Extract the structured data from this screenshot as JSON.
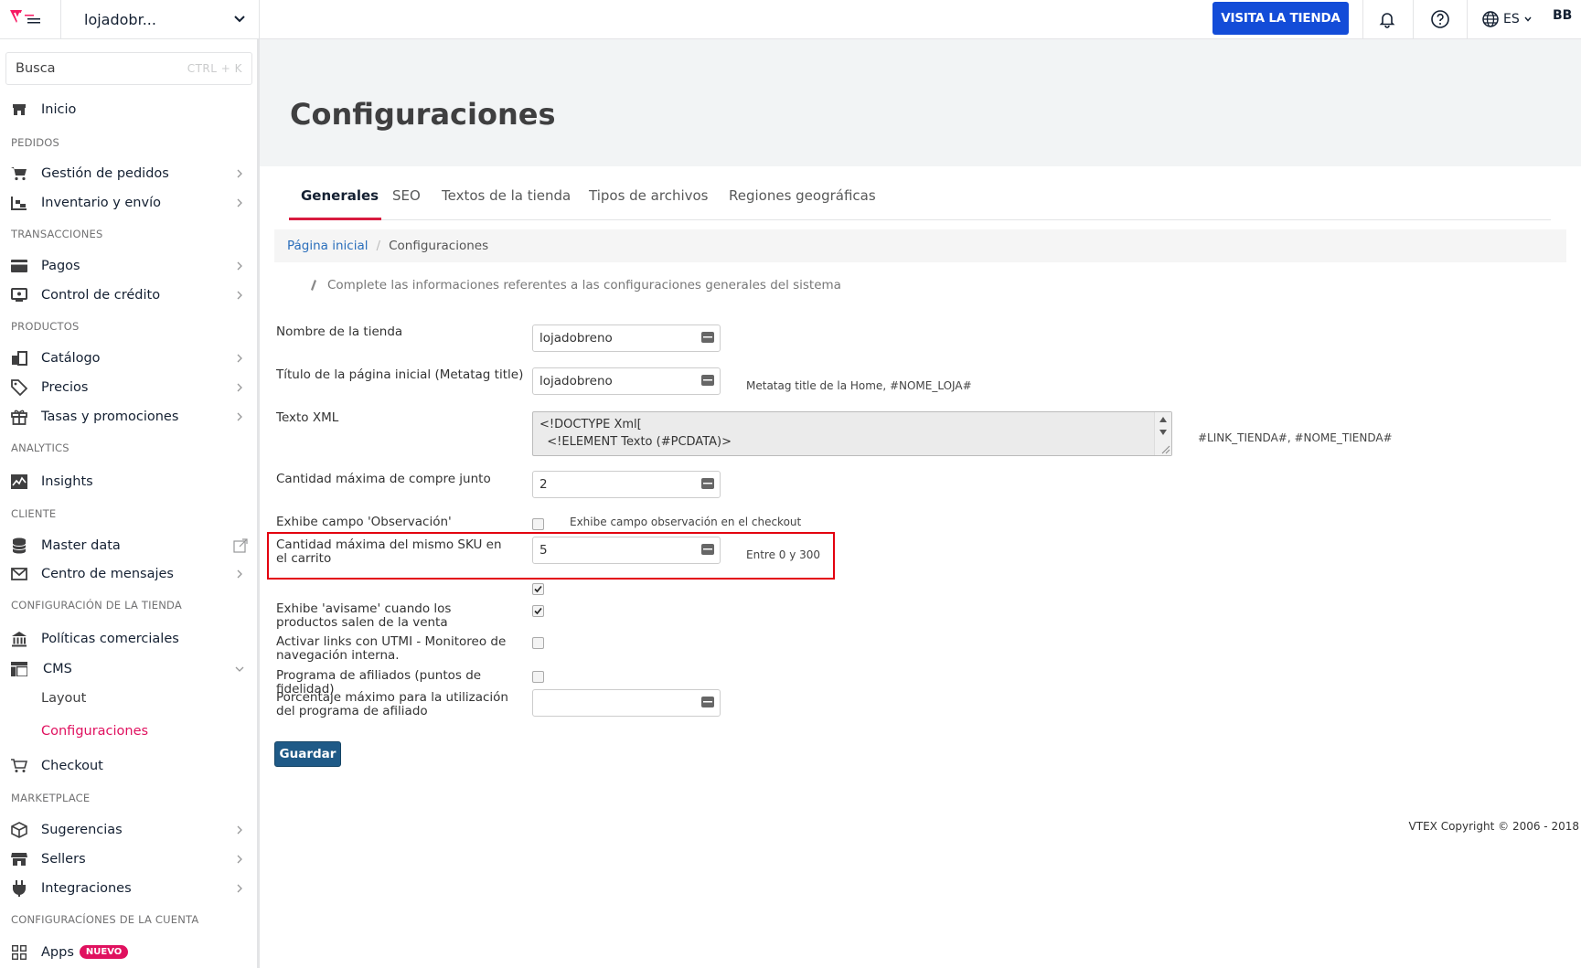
{
  "topbar": {
    "store_name": "lojadobr...",
    "visit_store": "VISITA LA TIENDA",
    "language": "ES",
    "avatar": "BB"
  },
  "sidebar": {
    "search_placeholder": "Busca",
    "search_shortcut": "CTRL + K",
    "home": "Inicio",
    "sections": {
      "pedidos": "PEDIDOS",
      "transacciones": "TRANSACCIONES",
      "productos": "PRODUCTOS",
      "analytics": "ANALYTICS",
      "cliente": "CLIENTE",
      "config_tienda": "CONFIGURACIÓN DE LA TIENDA",
      "marketplace": "MARKETPLACE",
      "config_cuenta": "CONFIGURACÍONES DE LA CUENTA"
    },
    "items": {
      "gestion_pedidos": "Gestión de pedidos",
      "inventario": "Inventario y envío",
      "pagos": "Pagos",
      "control_credito": "Control de crédito",
      "catalogo": "Catálogo",
      "precios": "Precios",
      "tasas": "Tasas y promociones",
      "insights": "Insights",
      "master_data": "Master data",
      "centro_mensajes": "Centro de mensajes",
      "politicas": "Políticas comerciales",
      "cms": "CMS",
      "layout": "Layout",
      "configuraciones": "Configuraciones",
      "checkout": "Checkout",
      "sugerencias": "Sugerencias",
      "sellers": "Sellers",
      "integraciones": "Integraciones",
      "apps": "Apps",
      "apps_badge": "NUEVO"
    }
  },
  "main": {
    "title": "Configuraciones",
    "tabs": [
      "Generales",
      "SEO",
      "Textos de la tienda",
      "Tipos de archivos",
      "Regiones geográficas"
    ],
    "breadcrumb": {
      "home": "Página inicial",
      "sep": "/",
      "current": "Configuraciones"
    },
    "helper": "Complete las informaciones referentes a las configuraciones generales del sistema",
    "form": {
      "store_name_label": "Nombre de la tienda",
      "store_name_value": "lojadobreno",
      "home_title_label": "Título de la página inicial (Metatag title)",
      "home_title_value": "lojadobreno",
      "home_title_hint": "Metatag title de la Home, #NOME_LOJA#",
      "xml_label": "Texto XML",
      "xml_line1": "<!DOCTYPE Xml[",
      "xml_line2": "  <!ELEMENT Texto (#PCDATA)>",
      "xml_hint": "#LINK_TIENDA#, #NOME_TIENDA#",
      "buy_together_label": "Cantidad máxima de compre junto",
      "buy_together_value": "2",
      "observation_label": "Exhibe campo 'Observación'",
      "observation_hint": "Exhibe campo observación en el checkout",
      "max_sku_label": "Cantidad máxima del mismo SKU en el carrito",
      "max_sku_value": "5",
      "max_sku_hint": "Entre 0 y 300",
      "notify_label": "Exhibe 'avisame' cuando los productos salen de la venta",
      "utmi_label": "Activar links con UTMI - Monitoreo de navegación interna.",
      "affiliates_label": "Programa de afiliados (puntos de fidelidad)",
      "affiliate_pct_label": "Porcentaje máximo para la utilización del programa de afiliado",
      "affiliate_pct_value": ""
    },
    "save": "Guardar",
    "copyright": "VTEX Copyright © 2006 - 2018"
  },
  "colors": {
    "brand_pink": "#e0115f",
    "visit_blue": "#134cd8",
    "save_blue": "#1f5a87",
    "highlight_red": "#e3000f"
  }
}
